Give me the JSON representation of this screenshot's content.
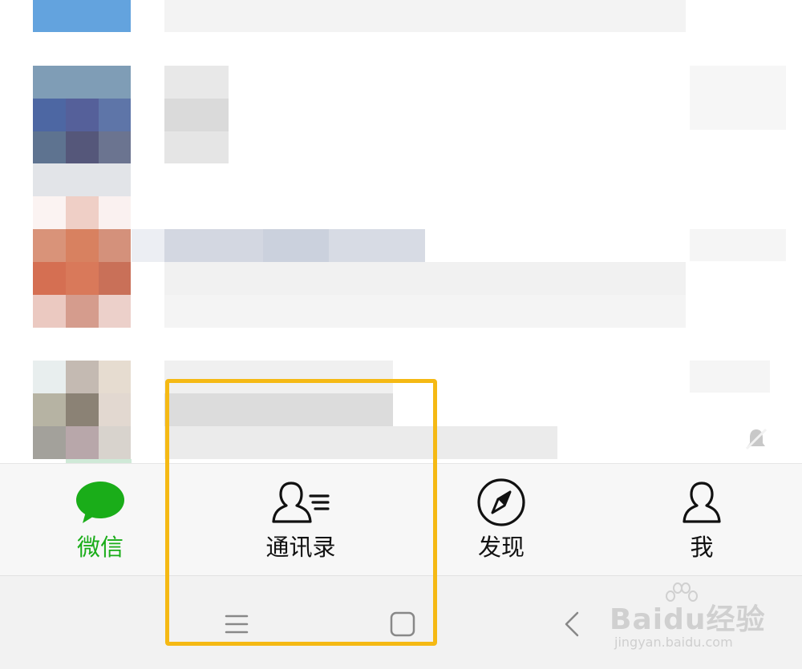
{
  "tab_bar": {
    "accent_color": "#1aad19",
    "tabs": [
      {
        "label": "微信",
        "icon": "chat-bubble-icon",
        "active": true
      },
      {
        "label": "通讯录",
        "icon": "contacts-icon",
        "active": false
      },
      {
        "label": "发现",
        "icon": "compass-icon",
        "active": false
      },
      {
        "label": "我",
        "icon": "person-icon",
        "active": false
      }
    ]
  },
  "system_nav": {
    "buttons": [
      {
        "icon": "menu-icon"
      },
      {
        "icon": "home-square-icon"
      },
      {
        "icon": "back-chevron-icon"
      }
    ]
  },
  "annotation": {
    "highlight_color": "#f5b914"
  },
  "watermark": {
    "brand": "Baidu经验",
    "url": "jingyan.baidu.com"
  }
}
